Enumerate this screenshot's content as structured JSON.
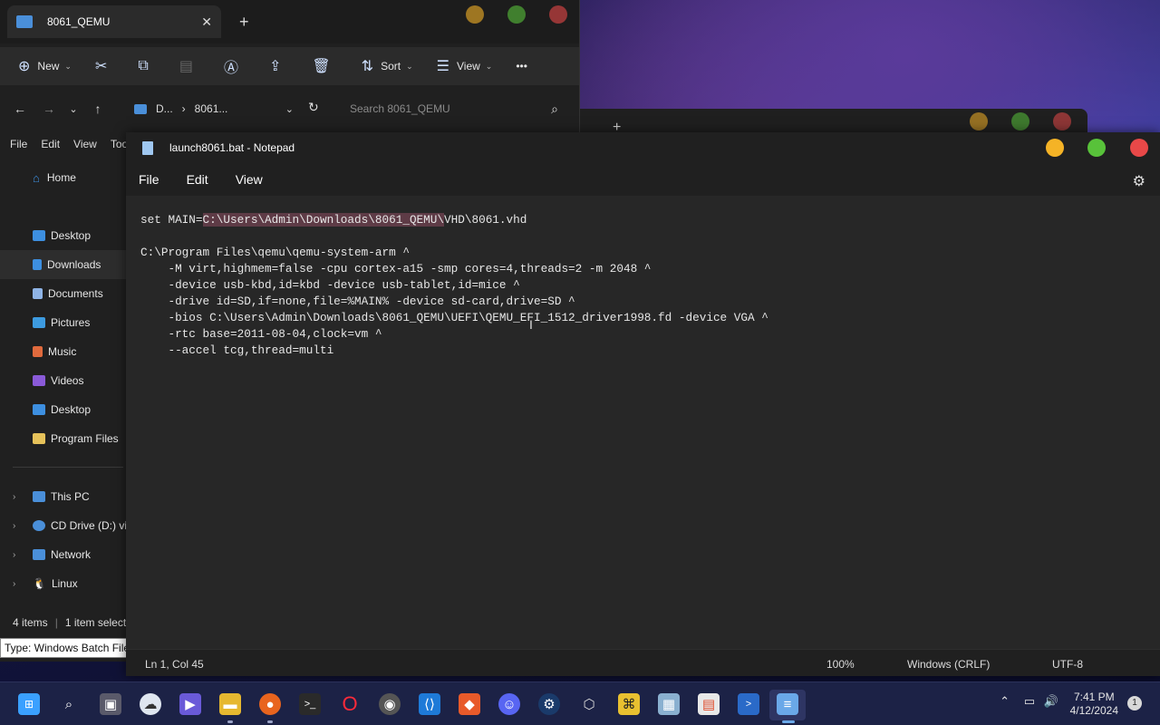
{
  "explorer": {
    "tab_title": "8061_QEMU",
    "toolbar": {
      "new": "New",
      "sort": "Sort",
      "view": "View",
      "more": "•••"
    },
    "address": {
      "seg1": "D...",
      "seg2": "8061..."
    },
    "search_placeholder": "Search 8061_QEMU",
    "menu": [
      "File",
      "Edit",
      "View",
      "Too"
    ],
    "sidebar": [
      {
        "label": "Home",
        "icon": "home-icon",
        "color": "#3d8fe0"
      },
      {
        "label": "Desktop",
        "icon": "desktop-icon",
        "color": "#3d8fe0"
      },
      {
        "label": "Downloads",
        "icon": "downloads-icon",
        "color": "#3d8fe0"
      },
      {
        "label": "Documents",
        "icon": "documents-icon",
        "color": "#8fb4e6"
      },
      {
        "label": "Pictures",
        "icon": "pictures-icon",
        "color": "#3d9be0"
      },
      {
        "label": "Music",
        "icon": "music-icon",
        "color": "#e06a3d"
      },
      {
        "label": "Videos",
        "icon": "videos-icon",
        "color": "#8a5ad8"
      },
      {
        "label": "Desktop",
        "icon": "desktop-icon",
        "color": "#3d8fe0"
      },
      {
        "label": "Program Files",
        "icon": "folder-icon",
        "color": "#e6c25a"
      }
    ],
    "tree": [
      {
        "label": "This PC",
        "icon": "pc-icon"
      },
      {
        "label": "CD Drive (D:) vi",
        "icon": "cd-drive-icon"
      },
      {
        "label": "Network",
        "icon": "network-icon"
      },
      {
        "label": "Linux",
        "icon": "linux-icon"
      }
    ],
    "status": {
      "items": "4 items",
      "selected": "1 item select"
    },
    "tooltip": "Type: Windows Batch File,"
  },
  "notepad": {
    "title": "launch8061.bat - Notepad",
    "menu": {
      "file": "File",
      "edit": "Edit",
      "view": "View"
    },
    "lines": {
      "l1_pre": "set MAIN=",
      "l1_hl": "C:\\Users\\Admin\\Downloads\\8061_QEMU\\",
      "l1_post": "VHD\\8061.vhd",
      "l3": "C:\\Program Files\\qemu\\qemu-system-arm ^",
      "l4": "    -M virt,highmem=false -cpu cortex-a15 -smp cores=4,threads=2 -m 2048 ^",
      "l5": "    -device usb-kbd,id=kbd -device usb-tablet,id=mice ^",
      "l6": "    -drive id=SD,if=none,file=%MAIN% -device sd-card,drive=SD ^",
      "l7": "    -bios C:\\Users\\Admin\\Downloads\\8061_QEMU\\UEFI\\QEMU_EFI_1512_driver1998.fd -device VGA ^",
      "l8": "    -rtc base=2011-08-04,clock=vm ^",
      "l9": "    --accel tcg,thread=multi"
    },
    "status": {
      "position": "Ln 1, Col 45",
      "zoom": "100%",
      "line_ending": "Windows (CRLF)",
      "encoding": "UTF-8"
    }
  },
  "window_controls": {
    "minimize_color": "#f5b326",
    "maximize_color": "#58c23a",
    "close_color": "#e84848"
  },
  "taskbar": {
    "time": "7:41 PM",
    "date": "4/12/2024",
    "notification_count": "1",
    "apps": [
      "start-icon",
      "search-icon",
      "task-view-icon",
      "widgets-icon",
      "teams-icon",
      "file-explorer-icon",
      "firefox-icon",
      "terminal-icon",
      "opera-icon",
      "obs-icon",
      "vscode-icon",
      "git-icon",
      "discord-icon",
      "steam-icon",
      "virtualbox-icon",
      "archive-icon",
      "monitor-icon",
      "store-icon",
      "powershell-icon",
      "notepad-icon"
    ]
  }
}
